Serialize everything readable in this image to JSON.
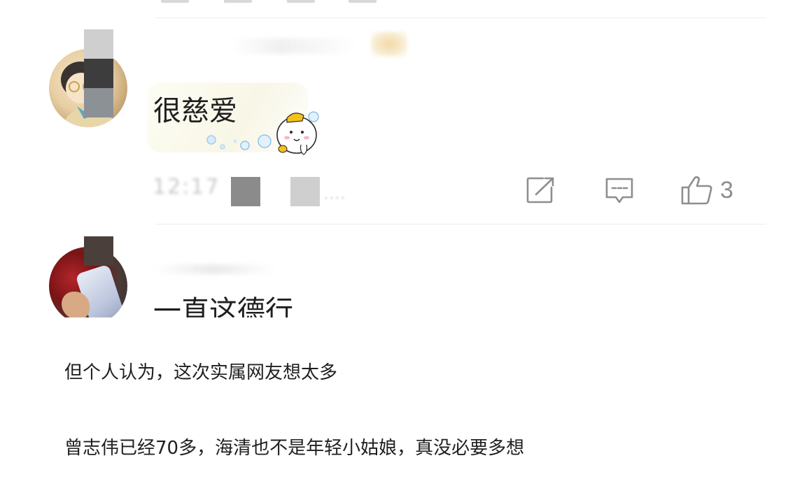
{
  "comments": [
    {
      "text": "很慈爱",
      "likes": "3",
      "sticker": "bubble-emoji-sticker"
    },
    {
      "text": "一直这德行"
    }
  ],
  "article": {
    "paragraphs": [
      "但个人认为，这次实属网友想太多",
      "曾志伟已经70多，海清也不是年轻小姑娘，真没必要多想"
    ]
  },
  "icons": {
    "share": "share-icon",
    "reply": "comment-icon",
    "like": "thumbs-up-icon"
  },
  "colors": {
    "text": "#1f1f1f",
    "meta": "#8e8e8e",
    "divider": "#ececec",
    "background": "#ffffff"
  }
}
